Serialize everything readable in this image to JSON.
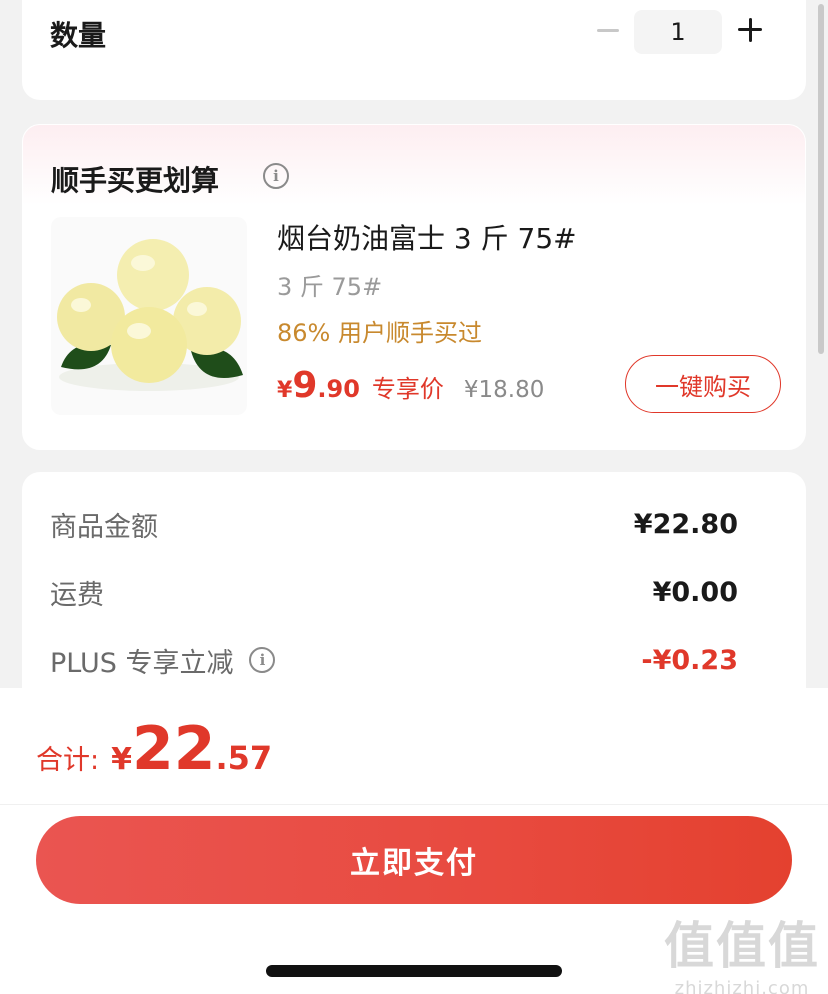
{
  "quantity": {
    "label": "数量",
    "value": "1",
    "minus_icon": "minus-icon",
    "plus_icon": "plus-icon"
  },
  "upsell": {
    "title": "顺手买更划算",
    "info_icon": "info-icon",
    "product": {
      "image_icon": "apple-product-image",
      "name": "烟台奶油富士 3 斤 75#",
      "spec": "3 斤 75#",
      "social_proof": "86% 用户顺手买过",
      "price_symbol": "¥",
      "price_integer": "9",
      "price_decimal": ".90",
      "price_tag": "专享价",
      "original_price": "¥18.80"
    },
    "buy_button_label": "一键购买"
  },
  "summary": {
    "rows": [
      {
        "label": "商品金额",
        "value": "¥22.80"
      },
      {
        "label": "运费",
        "value": "¥0.00"
      },
      {
        "label": "PLUS 专享立减",
        "value": "-¥0.23"
      }
    ]
  },
  "footer": {
    "total_label": "合计:",
    "total_symbol": "¥",
    "total_integer": "22",
    "total_decimal": ".57",
    "pay_button_label": "立即支付"
  },
  "watermark": {
    "big": "值值值",
    "small": "zhizhizhi.com"
  },
  "colors": {
    "accent_red": "#e0382a",
    "social_proof_orange": "#c8892e",
    "pay_button_gradient": [
      "#ea5551",
      "#e4412f"
    ]
  }
}
